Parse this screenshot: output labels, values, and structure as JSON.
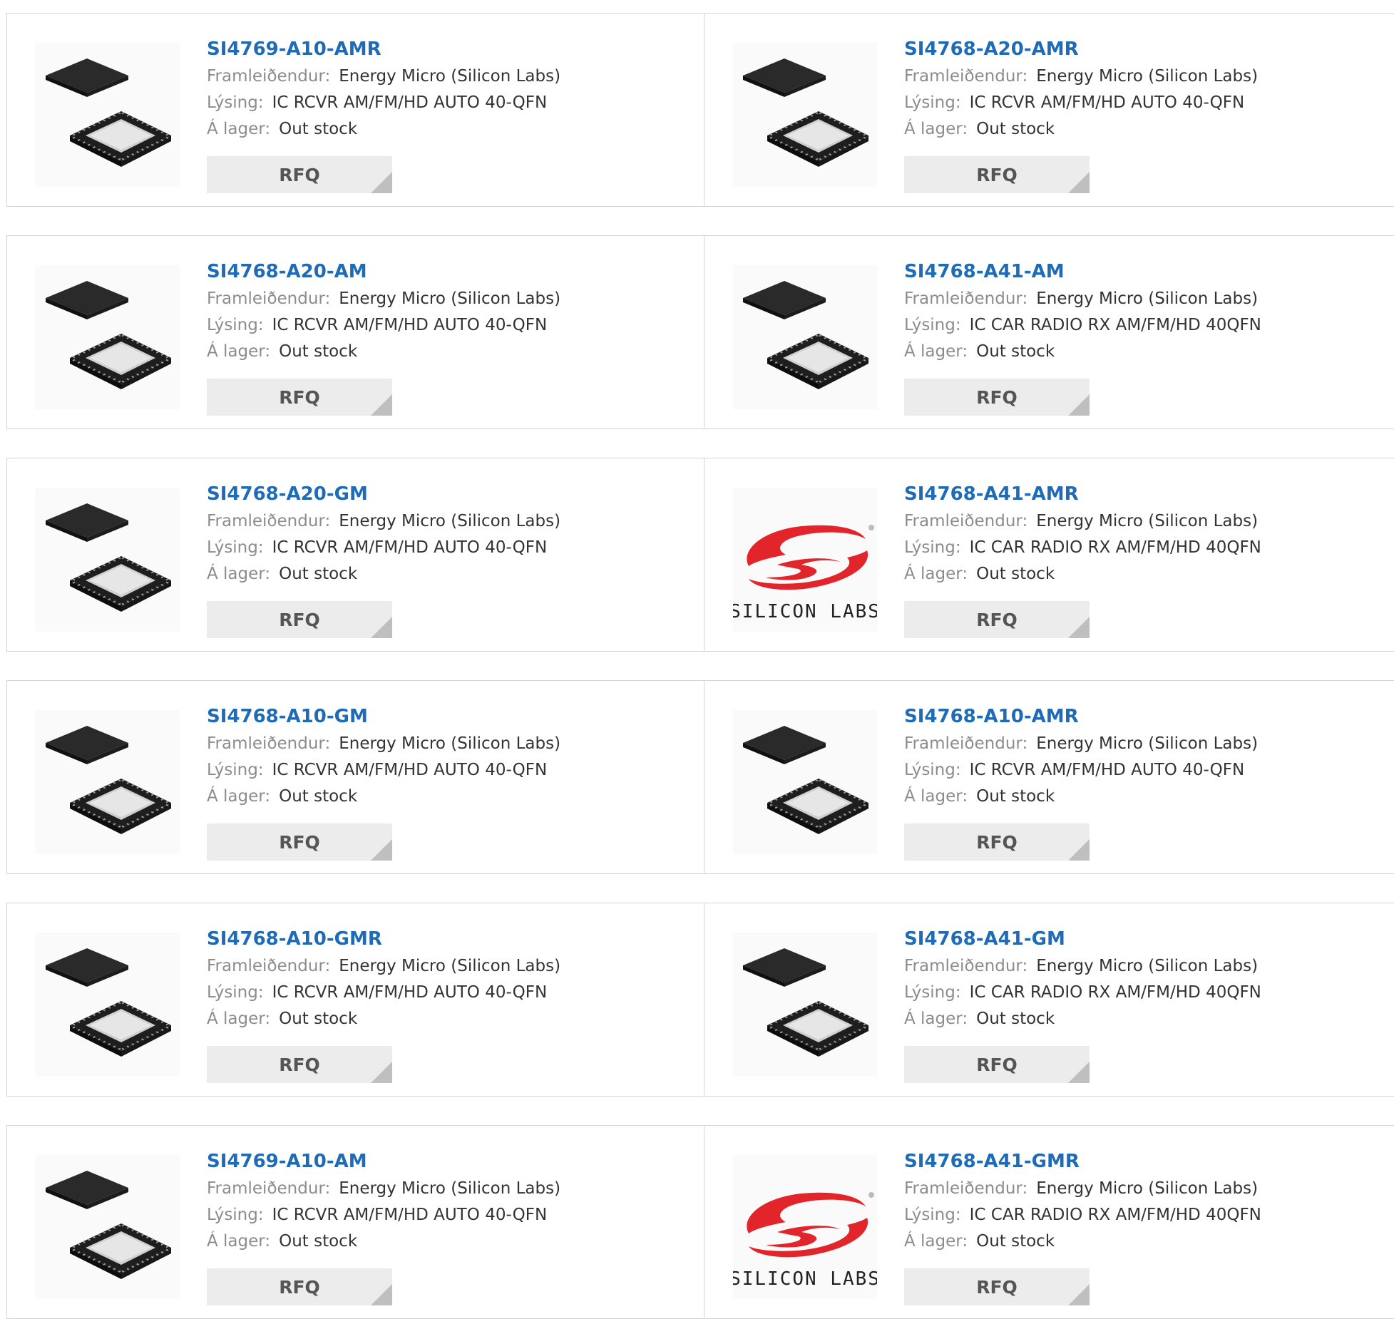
{
  "labels": {
    "manufacturer": "Framleiðendur:",
    "description": "Lýsing:",
    "stock": "Á lager:",
    "rfq": "RFQ"
  },
  "colors": {
    "part_link": "#1f6bb5",
    "label": "#8c8c8c",
    "value": "#333333",
    "rfq_bg": "#ececec",
    "logo_red": "#e2242b"
  },
  "products": [
    {
      "part": "SI4769-A10-AMR",
      "manufacturer": "Energy Micro (Silicon Labs)",
      "description": "IC RCVR AM/FM/HD AUTO 40-QFN",
      "stock": "Out stock",
      "image": "qfn-chip"
    },
    {
      "part": "SI4768-A20-AMR",
      "manufacturer": "Energy Micro (Silicon Labs)",
      "description": "IC RCVR AM/FM/HD AUTO 40-QFN",
      "stock": "Out stock",
      "image": "qfn-chip"
    },
    {
      "part": "SI4768-A20-AM",
      "manufacturer": "Energy Micro (Silicon Labs)",
      "description": "IC RCVR AM/FM/HD AUTO 40-QFN",
      "stock": "Out stock",
      "image": "qfn-chip"
    },
    {
      "part": "SI4768-A41-AM",
      "manufacturer": "Energy Micro (Silicon Labs)",
      "description": "IC CAR RADIO RX AM/FM/HD 40QFN",
      "stock": "Out stock",
      "image": "qfn-chip"
    },
    {
      "part": "SI4768-A20-GM",
      "manufacturer": "Energy Micro (Silicon Labs)",
      "description": "IC RCVR AM/FM/HD AUTO 40-QFN",
      "stock": "Out stock",
      "image": "qfn-chip"
    },
    {
      "part": "SI4768-A41-AMR",
      "manufacturer": "Energy Micro (Silicon Labs)",
      "description": "IC CAR RADIO RX AM/FM/HD 40QFN",
      "stock": "Out stock",
      "image": "silicon-labs-logo",
      "logo_text": "SILICON LABS"
    },
    {
      "part": "SI4768-A10-GM",
      "manufacturer": "Energy Micro (Silicon Labs)",
      "description": "IC RCVR AM/FM/HD AUTO 40-QFN",
      "stock": "Out stock",
      "image": "qfn-chip"
    },
    {
      "part": "SI4768-A10-AMR",
      "manufacturer": "Energy Micro (Silicon Labs)",
      "description": "IC RCVR AM/FM/HD AUTO 40-QFN",
      "stock": "Out stock",
      "image": "qfn-chip"
    },
    {
      "part": "SI4768-A10-GMR",
      "manufacturer": "Energy Micro (Silicon Labs)",
      "description": "IC RCVR AM/FM/HD AUTO 40-QFN",
      "stock": "Out stock",
      "image": "qfn-chip"
    },
    {
      "part": "SI4768-A41-GM",
      "manufacturer": "Energy Micro (Silicon Labs)",
      "description": "IC CAR RADIO RX AM/FM/HD 40QFN",
      "stock": "Out stock",
      "image": "qfn-chip"
    },
    {
      "part": "SI4769-A10-AM",
      "manufacturer": "Energy Micro (Silicon Labs)",
      "description": "IC RCVR AM/FM/HD AUTO 40-QFN",
      "stock": "Out stock",
      "image": "qfn-chip"
    },
    {
      "part": "SI4768-A41-GMR",
      "manufacturer": "Energy Micro (Silicon Labs)",
      "description": "IC CAR RADIO RX AM/FM/HD 40QFN",
      "stock": "Out stock",
      "image": "silicon-labs-logo",
      "logo_text": "SILICON LABS"
    }
  ]
}
